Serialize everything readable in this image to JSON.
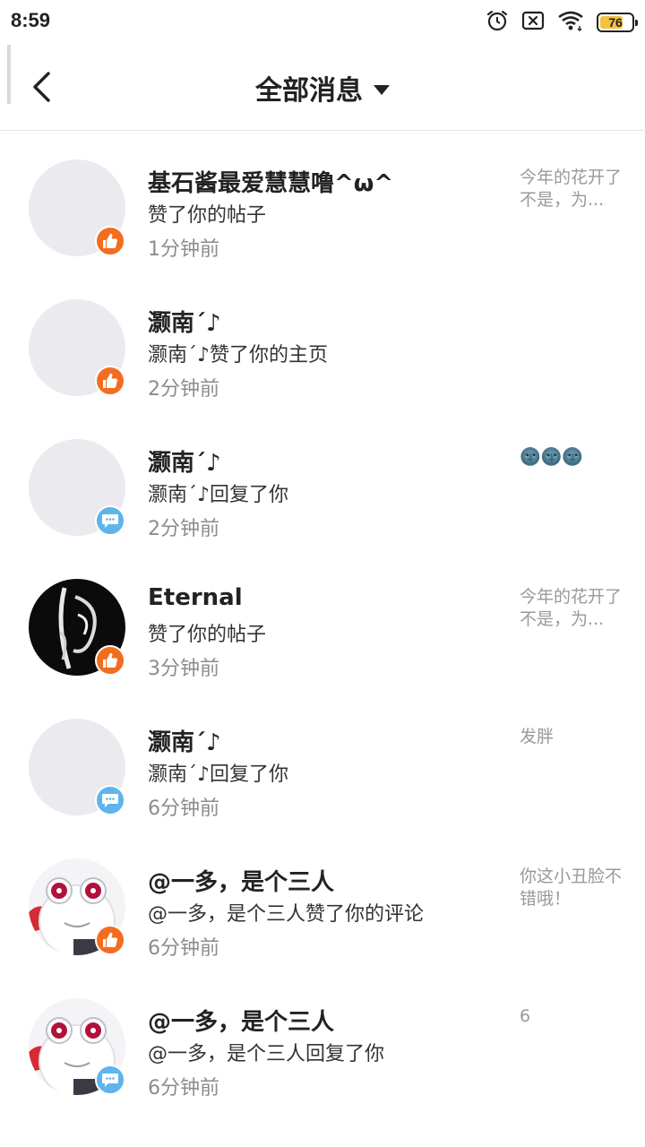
{
  "status_bar": {
    "time": "8:59",
    "battery_level": "76",
    "battery_fraction": 0.76,
    "icons": [
      "alarm-icon",
      "no-sim-icon",
      "wifi-icon",
      "battery-icon"
    ]
  },
  "header": {
    "title": "全部消息"
  },
  "colors": {
    "like_badge": "#f36d21",
    "reply_badge": "#5fb4ec",
    "time_text": "#8c8c8c",
    "preview_text": "#999999"
  },
  "messages": [
    {
      "name": "",
      "desc": "",
      "time": "1分钟前",
      "preview": "为...",
      "type": "like",
      "avatar": "sketch"
    },
    {
      "name": "基石酱最爱慧慧噜^ω^",
      "desc": "赞了你的帖子",
      "time": "1分钟前",
      "preview": "今年的花开了不是，为...",
      "type": "like",
      "avatar": "blank"
    },
    {
      "name": "灏南´♪",
      "desc": "灏南´♪赞了你的主页",
      "time": "2分钟前",
      "preview": "",
      "type": "like",
      "avatar": "blank"
    },
    {
      "name": "灏南´♪",
      "desc": "灏南´♪回复了你",
      "time": "2分钟前",
      "preview": "🌚🌚🌚",
      "type": "reply",
      "avatar": "blank"
    },
    {
      "name": "Eternal",
      "desc": "赞了你的帖子",
      "time": "3分钟前",
      "preview": "今年的花开了不是，为...",
      "type": "like",
      "avatar": "dark"
    },
    {
      "name": "灏南´♪",
      "desc": "灏南´♪回复了你",
      "time": "6分钟前",
      "preview": "发胖",
      "type": "reply",
      "avatar": "blank"
    },
    {
      "name": "@一多，是个三人",
      "desc": "@一多，是个三人赞了你的评论",
      "time": "6分钟前",
      "preview": "你这小丑脸不错哦！",
      "type": "like",
      "avatar": "robot"
    },
    {
      "name": "@一多，是个三人",
      "desc": "@一多，是个三人回复了你",
      "time": "6分钟前",
      "preview": "6",
      "type": "reply",
      "avatar": "robot"
    }
  ]
}
